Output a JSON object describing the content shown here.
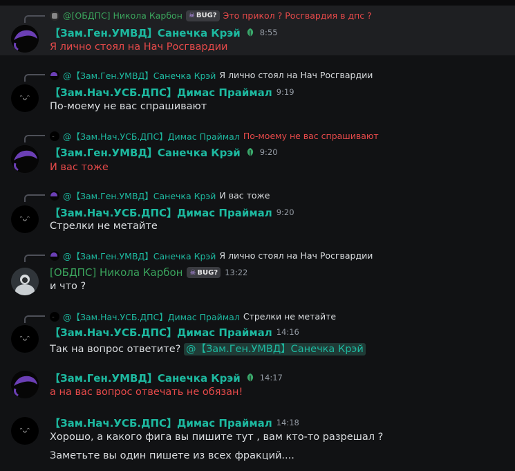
{
  "badge_text": "BUG?",
  "messages": [
    {
      "reply": {
        "author": "@[ОБДПС] Никола Карбон",
        "text": "Это прикол ? Росгвардия в дпс ?"
      },
      "author": "【Зам.Ген.УМВД】Санечка Крэй",
      "time": "8:55",
      "text": "Я лично стоял на Нач Росгвардии"
    },
    {
      "reply": {
        "author": "@【Зам.Ген.УМВД】Санечка Крэй",
        "text": "Я лично стоял на Нач Росгвардии"
      },
      "author": "【Зам.Нач.УСБ.ДПС】Димас Праймал",
      "time": "9:19",
      "text": "По-моему не вас спрашивают"
    },
    {
      "reply": {
        "author": "@【Зам.Нач.УСБ.ДПС】Димас Праймал",
        "text": "По-моему не вас спрашивают"
      },
      "author": "【Зам.Ген.УМВД】Санечка Крэй",
      "time": "9:20",
      "text": "И вас тоже"
    },
    {
      "reply": {
        "author": "@【Зам.Ген.УМВД】Санечка Крэй",
        "text": "И вас тоже"
      },
      "author": "【Зам.Нач.УСБ.ДПС】Димас Праймал",
      "time": "9:20",
      "text": "Стрелки не метайте"
    },
    {
      "reply": {
        "author": "@【Зам.Ген.УМВД】Санечка Крэй",
        "text": "Я лично стоял на Нач Росгвардии"
      },
      "author": "[ОБДПС] Никола Карбон",
      "time": "13:22",
      "text": "и что ?"
    },
    {
      "reply": {
        "author": "@【Зам.Нач.УСБ.ДПС】Димас Праймал",
        "text": "Стрелки не метайте"
      },
      "author": "【Зам.Нач.УСБ.ДПС】Димас Праймал",
      "time": "14:16",
      "text": "Так на вопрос ответите?",
      "mention": "@【Зам.Ген.УМВД】Санечка Крэй"
    },
    {
      "author": "【Зам.Ген.УМВД】Санечка Крэй",
      "time": "14:17",
      "text": "а на вас вопрос отвечать не обязан!"
    },
    {
      "author": "【Зам.Нач.УСБ.ДПС】Димас Праймал",
      "time": "14:18",
      "text": "Хорошо, а какого фига вы пишите тут , вам кто-то разрешал ?",
      "text2": "Заметьте вы один пишете из всех фракций...."
    }
  ]
}
